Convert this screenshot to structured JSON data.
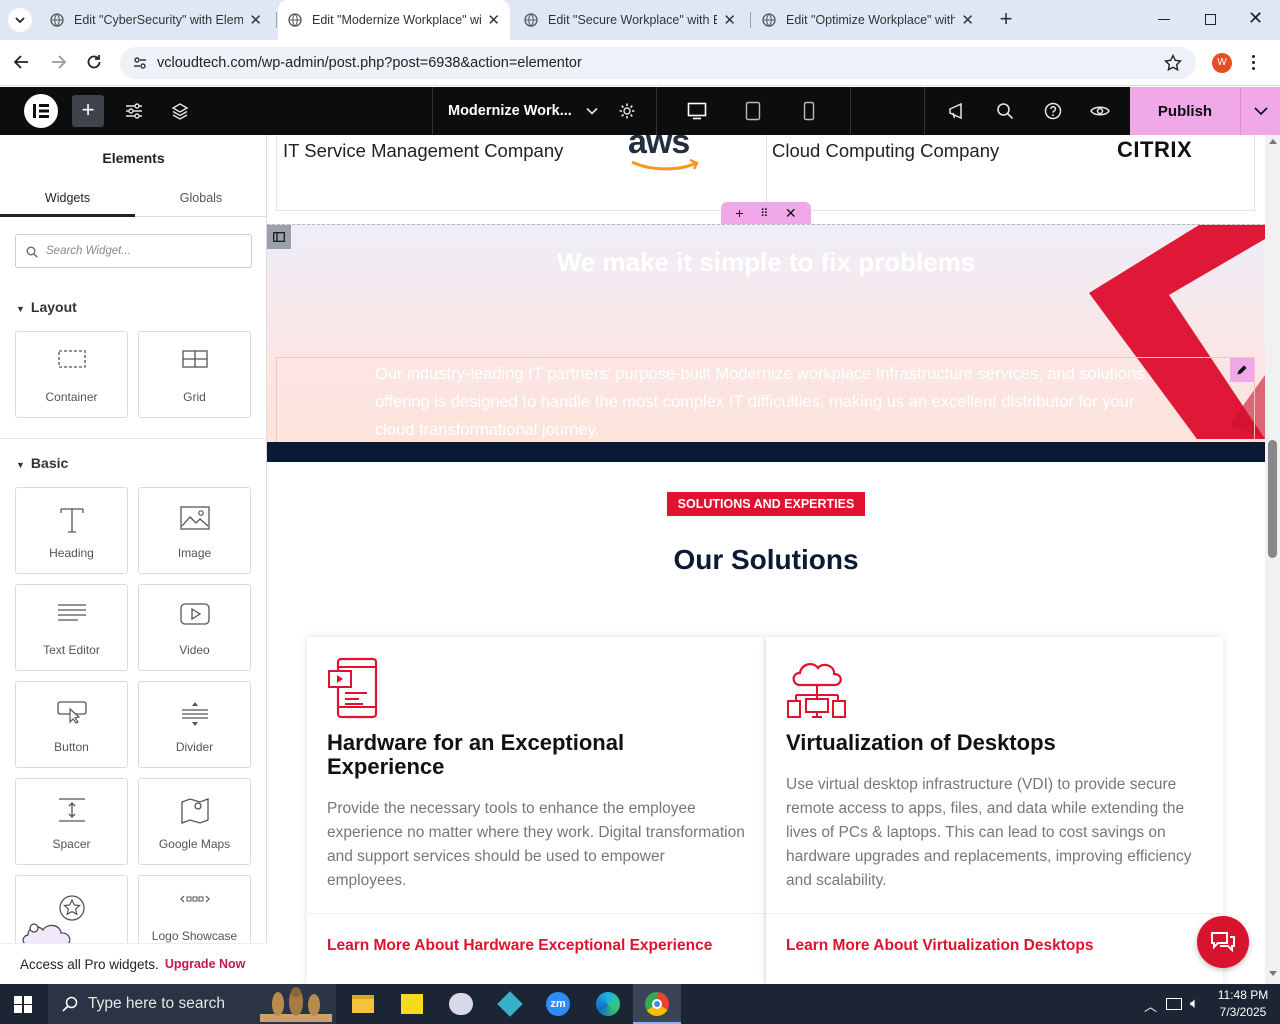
{
  "browser": {
    "tabs": [
      {
        "title": "Edit \"CyberSecurity\" with Elementor",
        "active": false
      },
      {
        "title": "Edit \"Modernize Workplace\" with Elementor",
        "active": true
      },
      {
        "title": "Edit \"Secure Workplace\" with Elementor",
        "active": false
      },
      {
        "title": "Edit \"Optimize Workplace\" with Elementor",
        "active": false
      }
    ],
    "url": "vcloudtech.com/wp-admin/post.php?post=6938&action=elementor",
    "profile_initial": "W"
  },
  "editor": {
    "page_name": "Modernize Work...",
    "publish_label": "Publish"
  },
  "panel": {
    "title": "Elements",
    "tabs": [
      "Widgets",
      "Globals"
    ],
    "search_placeholder": "Search Widget...",
    "sections": {
      "layout": {
        "title": "Layout",
        "widgets": [
          "Container",
          "Grid"
        ]
      },
      "basic": {
        "title": "Basic",
        "widgets": [
          "Heading",
          "Image",
          "Text Editor",
          "Video",
          "Button",
          "Divider",
          "Spacer",
          "Google Maps",
          "",
          "Logo Showcase"
        ]
      }
    },
    "pro_banner": {
      "text": "Access all Pro widgets.",
      "link": "Upgrade Now"
    }
  },
  "canvas": {
    "partners": [
      {
        "name": "IT Service Management Company",
        "logo": "aws"
      },
      {
        "name": "Cloud Computing Company",
        "logo": "CITRIX"
      }
    ],
    "hero": {
      "title": "We make it simple to fix problems",
      "text": "Our industry-leading IT partners' purpose-built Modernize workplace Infrastructure services, and solutions offering is designed to handle the most complex IT difficulties, making us an excellent distributor for your cloud transformational journey."
    },
    "solutions": {
      "badge": "SOLUTIONS AND EXPERTIES",
      "heading": "Our Solutions",
      "cards": [
        {
          "title": "Hardware for an Exceptional Experience",
          "text": "Provide the necessary tools to enhance the employee experience no matter where they work. Digital transformation and support services should be used to empower employees.",
          "link": "Learn More About Hardware Exceptional Experience"
        },
        {
          "title": "Virtualization of Desktops",
          "text": "Use virtual desktop infrastructure (VDI) to provide secure remote access to apps, files, and data while extending the lives of PCs & laptops. This can lead to cost savings on hardware upgrades and replacements, improving efficiency and scalability.",
          "link": "Learn More About Virtualization Desktops"
        }
      ]
    }
  },
  "taskbar": {
    "search_placeholder": "Type here to search",
    "time": "11:48 PM",
    "date": "7/3/2025"
  },
  "colors": {
    "accent": "#e0122f",
    "navy": "#0b1a34",
    "elementor_pink": "#f0a8e8"
  }
}
